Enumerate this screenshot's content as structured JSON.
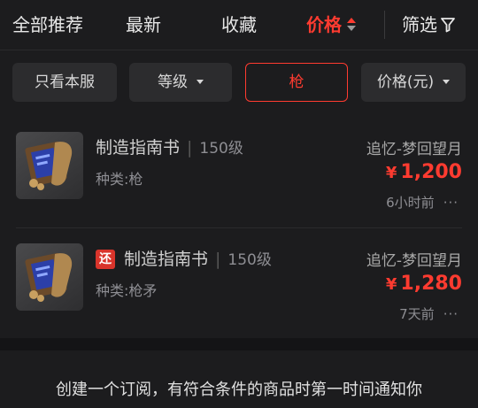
{
  "sort_tabs": {
    "recommended": "全部推荐",
    "newest": "最新",
    "favorites": "收藏",
    "price": "价格",
    "filter": "筛选"
  },
  "filters": {
    "own_server": "只看本服",
    "level": "等级",
    "weapon": "枪",
    "price": "价格(元)"
  },
  "items": [
    {
      "name": "制造指南书",
      "level": "150级",
      "category": "种类:枪",
      "server": "追忆-梦回望月",
      "currency": "¥",
      "price": "1,200",
      "time": "6小时前",
      "more": "···",
      "badge": ""
    },
    {
      "name": "制造指南书",
      "level": "150级",
      "category": "种类:枪矛",
      "server": "追忆-梦回望月",
      "currency": "¥",
      "price": "1,280",
      "time": "7天前",
      "more": "···",
      "badge": "还"
    }
  ],
  "subscribe_prompt": "创建一个订阅，有符合条件的商品时第一时间通知你",
  "colors": {
    "accent": "#ff3b30",
    "background": "#1c1c1e",
    "chip": "#2c2c2e"
  },
  "icons": {
    "sort": "sort-arrows-icon",
    "filter": "funnel-icon",
    "dropdown": "caret-down-icon",
    "item": "scroll-book-icon"
  }
}
